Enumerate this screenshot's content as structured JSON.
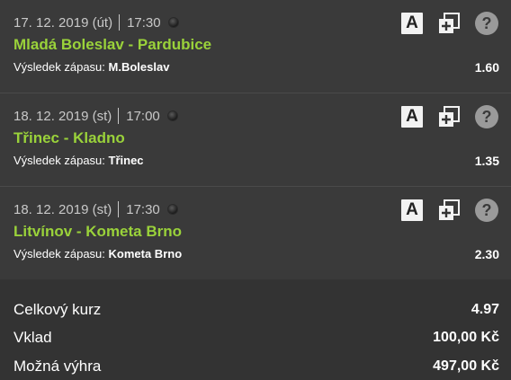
{
  "bets": [
    {
      "date": "17. 12. 2019 (út)",
      "time": "17:30",
      "match": "Mladá Boleslav - Pardubice",
      "market_label": "Výsledek zápasu:",
      "selection": "M.Boleslav",
      "odds": "1.60"
    },
    {
      "date": "18. 12. 2019 (st)",
      "time": "17:00",
      "match": "Třinec - Kladno",
      "market_label": "Výsledek zápasu:",
      "selection": "Třinec",
      "odds": "1.35"
    },
    {
      "date": "18. 12. 2019 (st)",
      "time": "17:30",
      "match": "Litvínov - Kometa Brno",
      "market_label": "Výsledek zápasu:",
      "selection": "Kometa Brno",
      "odds": "2.30"
    }
  ],
  "icons": {
    "a_letter": "A",
    "help_glyph": "?"
  },
  "summary": {
    "total_odds_label": "Celkový kurz",
    "total_odds": "4.97",
    "stake_label": "Vklad",
    "stake": "100,00 Kč",
    "payout_label": "Možná výhra",
    "payout": "497,00 Kč"
  },
  "colors": {
    "match_name": "#9ad23a",
    "panel_bg": "#3a3a3a",
    "summary_bg": "#333333"
  }
}
